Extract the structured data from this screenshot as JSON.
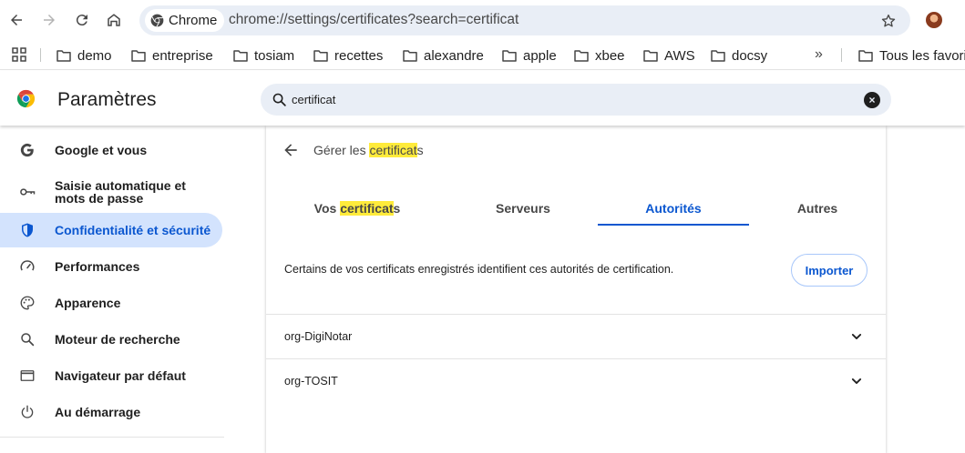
{
  "browser": {
    "chip_label": "Chrome",
    "url": "chrome://settings/certificates?search=certificat"
  },
  "bookmarks": {
    "items": [
      "demo",
      "entreprise",
      "tosiam",
      "recettes",
      "alexandre",
      "apple",
      "xbee",
      "AWS",
      "docsy"
    ],
    "more": "»",
    "all_bookmarks": "Tous les favoris"
  },
  "settings": {
    "title": "Paramètres",
    "search_value": "certificat"
  },
  "sidebar": {
    "items": [
      {
        "label": "Google et vous",
        "icon": "google-icon"
      },
      {
        "label": "Saisie automatique et mots de passe",
        "icon": "key-icon"
      },
      {
        "label": "Confidentialité et sécurité",
        "icon": "shield-icon"
      },
      {
        "label": "Performances",
        "icon": "speedometer-icon"
      },
      {
        "label": "Apparence",
        "icon": "palette-icon"
      },
      {
        "label": "Moteur de recherche",
        "icon": "search-icon"
      },
      {
        "label": "Navigateur par défaut",
        "icon": "browser-window-icon"
      },
      {
        "label": "Au démarrage",
        "icon": "power-icon"
      }
    ],
    "active_index": 2
  },
  "certificates": {
    "title_prefix": "Gérer les ",
    "title_highlight": "certificat",
    "title_suffix": "s",
    "tabs": [
      {
        "prefix": "Vos ",
        "highlight": "certificat",
        "suffix": "s"
      },
      {
        "label": "Serveurs"
      },
      {
        "label": "Autorités"
      },
      {
        "label": "Autres"
      }
    ],
    "active_tab": "Autorités",
    "description": "Certains de vos certificats enregistrés identifient ces autorités de certification.",
    "import_label": "Importer",
    "rows": [
      "org-DigiNotar",
      "org-TOSIT"
    ]
  },
  "colors": {
    "accent": "#0b57d0",
    "active_bg": "#d3e3fd",
    "highlight": "#ffeb3b",
    "omnibox_bg": "#e9eef6"
  }
}
